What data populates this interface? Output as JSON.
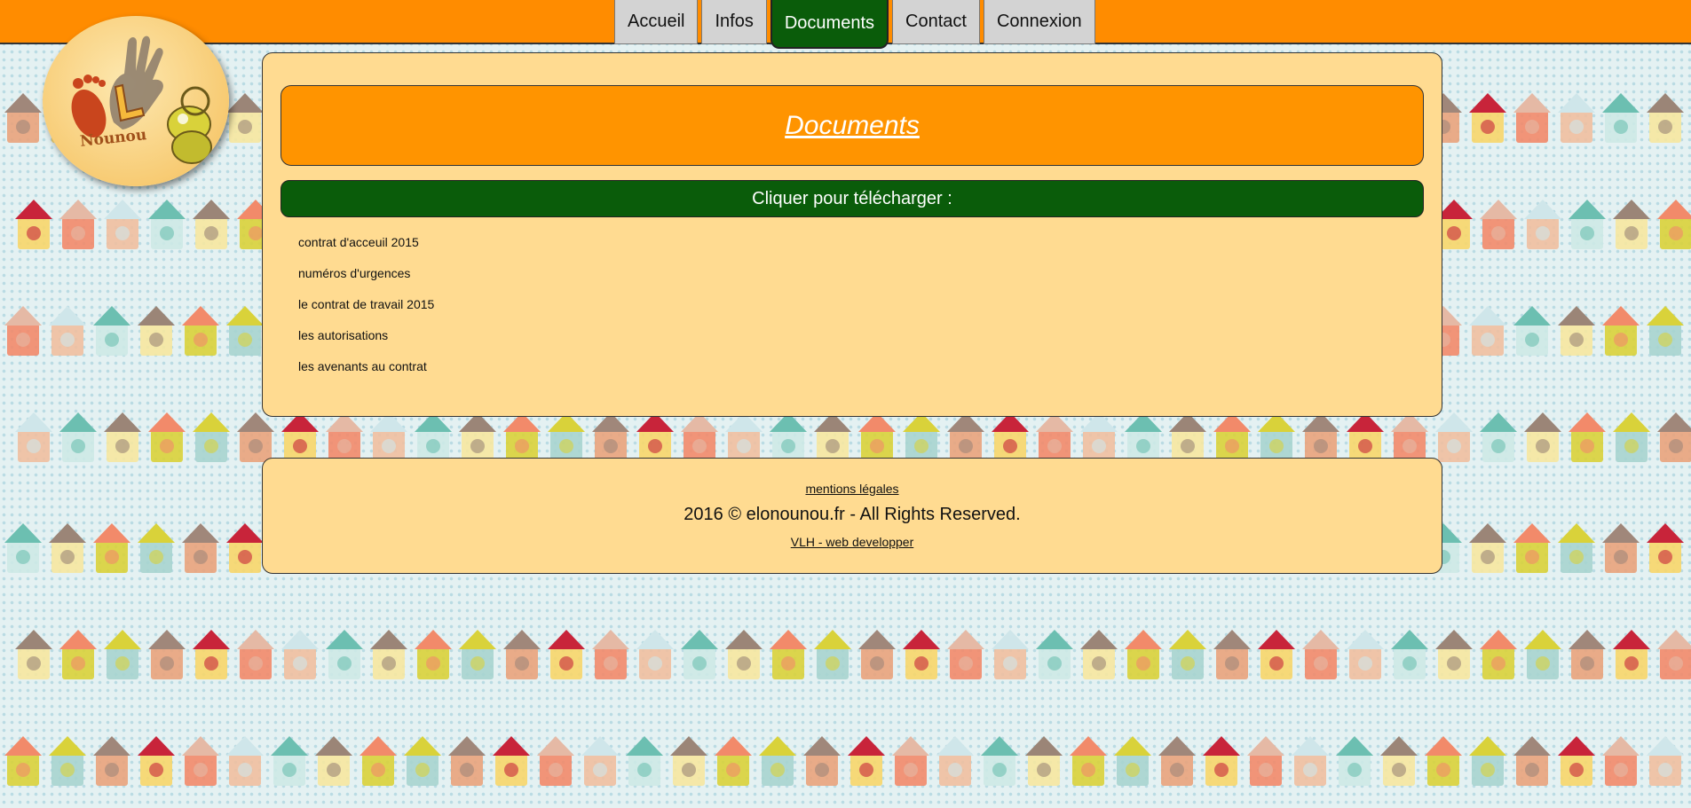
{
  "nav": {
    "items": [
      {
        "label": "Accueil",
        "active": false
      },
      {
        "label": "Infos",
        "active": false
      },
      {
        "label": "Documents",
        "active": true
      },
      {
        "label": "Contact",
        "active": false
      },
      {
        "label": "Connexion",
        "active": false
      }
    ]
  },
  "logo": {
    "text": "Nounou",
    "icon": "hand-footprint-pacifier-logo"
  },
  "main": {
    "title": "Documents",
    "download_label": "Cliquer pour télécharger :",
    "documents": [
      "contrat d'acceuil 2015",
      "numéros d'urgences",
      "le contrat de travail 2015",
      "les autorisations",
      "les avenants au contrat"
    ]
  },
  "footer": {
    "legal": "mentions légales",
    "copyright": "2016 © elonounou.fr - All Rights Reserved.",
    "developer": "VLH - web developper"
  },
  "colors": {
    "topbar": "#ff8c00",
    "nav_active": "#0a5c0a",
    "panel": "#ffdb91",
    "title_box": "#ff9400",
    "background": "#e4f1f2"
  }
}
